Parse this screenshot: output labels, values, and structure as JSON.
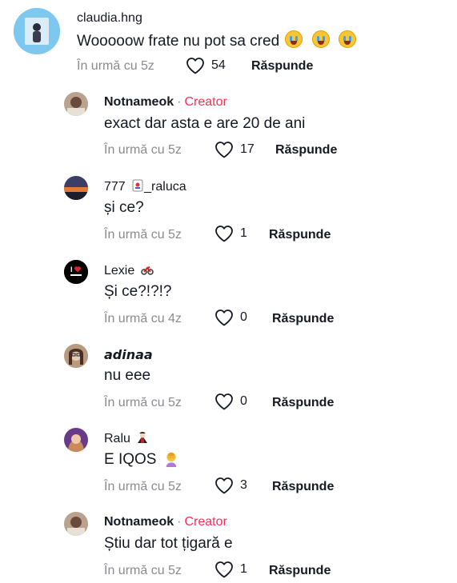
{
  "colors": {
    "creator": "#fe2c55",
    "muted": "#8a8b91",
    "text": "#161823"
  },
  "comments": [
    {
      "username": "claudia.hng",
      "creator_badge": "",
      "text": "Wooooow frate nu pot sa cred",
      "text_emoji": "loudly-crying-face x3",
      "time": "În urmă cu 5z",
      "likes": "54",
      "reply": "Răspunde"
    },
    {
      "username": "Notnameok",
      "creator_badge": "Creator",
      "text": "exact dar asta e are 20 de ani",
      "time": "În urmă cu 5z",
      "likes": "17",
      "reply": "Răspunde"
    },
    {
      "username": "777",
      "username_suffix": "_raluca",
      "username_emoji": "joker-card",
      "creator_badge": "",
      "text": "și ce?",
      "time": "În urmă cu 5z",
      "likes": "1",
      "reply": "Răspunde"
    },
    {
      "username": "Lexie",
      "username_emoji": "motorcycle",
      "creator_badge": "",
      "text": "Și ce?!?!?",
      "time": "În urmă cu 4z",
      "likes": "0",
      "reply": "Răspunde"
    },
    {
      "username": "𝙖𝙙𝙞𝙣𝙖𝙖",
      "creator_badge": "",
      "text": "nu eee",
      "time": "În urmă cu 5z",
      "likes": "0",
      "reply": "Răspunde"
    },
    {
      "username": "Ralu",
      "username_emoji": "vampire",
      "creator_badge": "",
      "text": "E IQOS",
      "text_emoji": "person-facepalming",
      "time": "În urmă cu 5z",
      "likes": "3",
      "reply": "Răspunde"
    },
    {
      "username": "Notnameok",
      "creator_badge": "Creator",
      "text": "Știu dar tot țigară e",
      "time": "În urmă cu 5z",
      "likes": "1",
      "reply": "Răspunde"
    }
  ]
}
